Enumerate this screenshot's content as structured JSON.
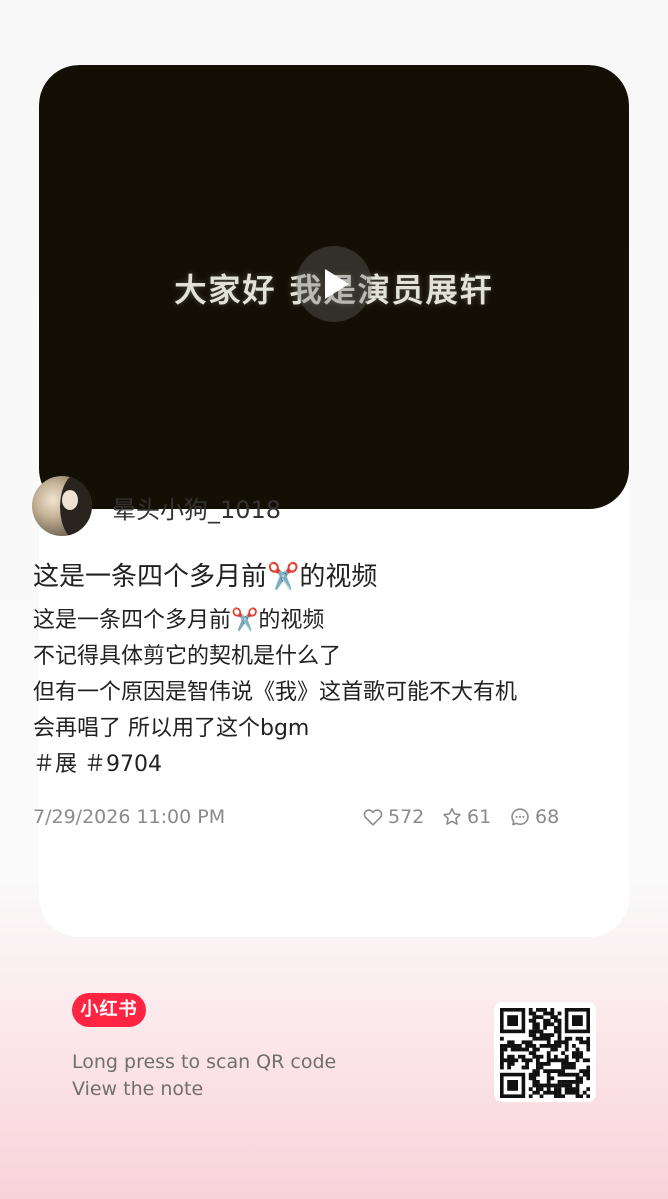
{
  "video": {
    "caption": "大家好 我是演员展轩"
  },
  "author": {
    "name": "晕头小狗_1018"
  },
  "note": {
    "title": "这是一条四个多月前✂️的视频",
    "body": [
      "这是一条四个多月前✂️的视频",
      "不记得具体剪它的契机是什么了",
      "但有一个原因是智伟说《我》这首歌可能不大有机",
      "会再唱了 所以用了这个bgm",
      "＃展 ＃9704"
    ],
    "date": "7/29/2026 11:00 PM",
    "likes": "572",
    "collects": "61",
    "comments": "68"
  },
  "footer": {
    "logo_text": "小红书",
    "scan_line1": "Long press to scan QR code",
    "scan_line2": "View the note"
  },
  "colors": {
    "brand": "#ff2442",
    "video_bg": "#140f05"
  },
  "icons": [
    "play-icon",
    "heart-icon",
    "star-icon",
    "comment-icon",
    "qr-code"
  ]
}
